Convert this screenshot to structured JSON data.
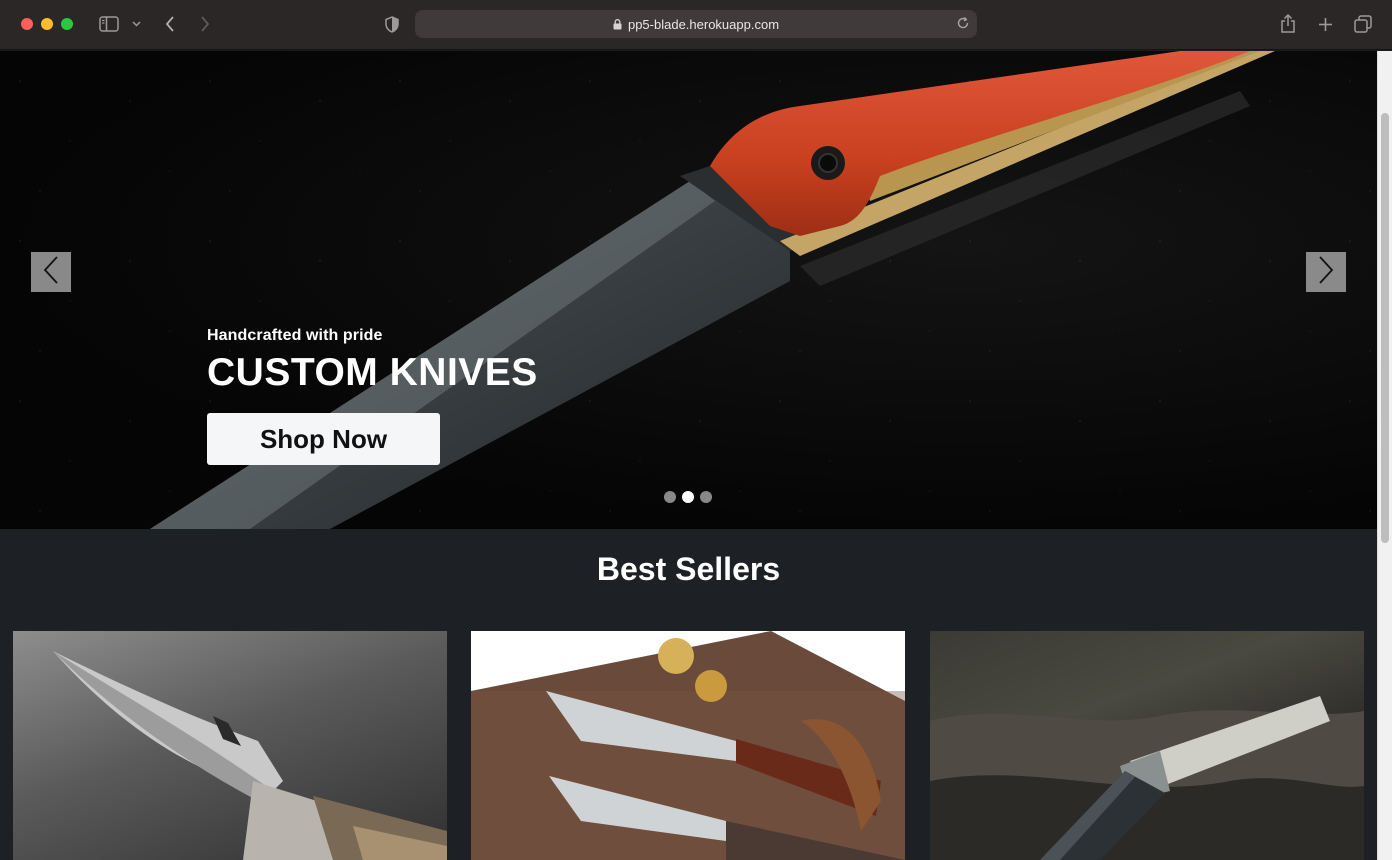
{
  "browser": {
    "url": "pp5-blade.herokuapp.com",
    "icons": {
      "sidebar": "sidebar-icon",
      "back": "chevron-left-icon",
      "forward": "chevron-right-icon",
      "privacy": "shield-icon",
      "lock": "lock-icon",
      "reload": "reload-icon",
      "share": "share-icon",
      "new_tab": "plus-icon",
      "tabs": "tabs-overview-icon"
    }
  },
  "hero": {
    "subtitle": "Handcrafted with pride",
    "title": "CUSTOM KNIVES",
    "cta_label": "Shop Now",
    "slides_count": 3,
    "active_slide": 2
  },
  "best_sellers": {
    "heading": "Best Sellers"
  },
  "colors": {
    "page_bg": "#1d2024",
    "button_bg": "#f4f6f8",
    "handle_orange": "#d4492a"
  }
}
